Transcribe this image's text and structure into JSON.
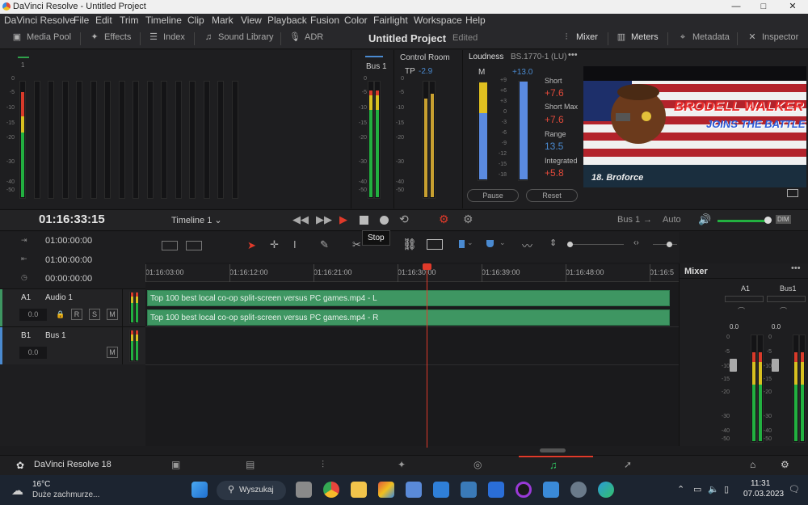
{
  "window": {
    "title": "DaVinci Resolve - Untitled Project",
    "minimize": "—",
    "maximize": "□",
    "close": "✕"
  },
  "menu": [
    "DaVinci Resolve",
    "File",
    "Edit",
    "Trim",
    "Timeline",
    "Clip",
    "Mark",
    "View",
    "Playback",
    "Fusion",
    "Color",
    "Fairlight",
    "Workspace",
    "Help"
  ],
  "toolbar": {
    "media_pool": "Media Pool",
    "effects": "Effects",
    "index": "Index",
    "sound_library": "Sound Library",
    "adr": "ADR",
    "project_title": "Untitled Project",
    "project_state": "Edited",
    "mixer": "Mixer",
    "meters": "Meters",
    "metadata": "Metadata",
    "inspector": "Inspector"
  },
  "meters": {
    "track_label": "1",
    "scale": [
      "0",
      "-5",
      "-10",
      "-15",
      "-20",
      "-30",
      "-40",
      "-50"
    ],
    "bus_label": "Bus 1",
    "control_room": {
      "title": "Control Room",
      "tp_label": "TP",
      "tp_value": "-2.9"
    },
    "loudness": {
      "title": "Loudness",
      "standard": "BS.1770-1 (LU)",
      "m_label": "M",
      "m_value": "+13.0",
      "scale": [
        "+9",
        "+6",
        "+3",
        "0",
        "-3",
        "-6",
        "-9",
        "-12",
        "-15",
        "-18"
      ],
      "short_label": "Short",
      "short_value": "+7.6",
      "short_max_label": "Short Max",
      "short_max_value": "+7.6",
      "range_label": "Range",
      "range_value": "13.5",
      "integrated_label": "Integrated",
      "integrated_value": "+5.8",
      "pause": "Pause",
      "reset": "Reset"
    }
  },
  "viewer": {
    "banner_line1": "BRODELL WALKER",
    "banner_line2": "JOINS THE BATTLE",
    "caption": "18. Broforce"
  },
  "transport": {
    "timecode": "01:16:33:15",
    "timeline_name": "Timeline 1",
    "bus": "Bus 1",
    "auto": "Auto",
    "dim": "DIM",
    "tooltip": "Stop"
  },
  "tracks_panel": {
    "in": "01:00:00:00",
    "out": "01:00:00:00",
    "duration": "00:00:00:00",
    "tracks": [
      {
        "id": "A1",
        "name": "Audio 1",
        "volume": "0.0",
        "r": "R",
        "s": "S",
        "m": "M"
      },
      {
        "id": "B1",
        "name": "Bus 1",
        "volume": "0.0",
        "m": "M"
      }
    ]
  },
  "ruler": [
    "01:16:03:00",
    "01:16:12:00",
    "01:16:21:00",
    "01:16:30:00",
    "01:16:39:00",
    "01:16:48:00",
    "01:16:5"
  ],
  "clips": [
    "Top 100 best local co-op split-screen versus PC games.mp4 - L",
    "Top 100 best local co-op split-screen versus PC games.mp4 - R"
  ],
  "mixer_panel": {
    "title": "Mixer",
    "channels": [
      {
        "label": "A1",
        "value": "0.0"
      },
      {
        "label": "Bus1",
        "value": "0.0"
      }
    ],
    "scale": [
      "0",
      "-5",
      "-10",
      "-15",
      "-20",
      "-30",
      "-40",
      "-50"
    ]
  },
  "app_footer": {
    "name": "DaVinci Resolve 18"
  },
  "taskbar": {
    "weather_temp": "16°C",
    "weather_desc": "Duże zachmurze...",
    "search": "Wyszukaj",
    "time": "11:31",
    "date": "07.03.2023"
  },
  "colors": {
    "accent_blue": "#4a8ad0",
    "clip_green": "#3e9662",
    "playhead_red": "#e03a2a",
    "meter_green": "#22b040"
  }
}
